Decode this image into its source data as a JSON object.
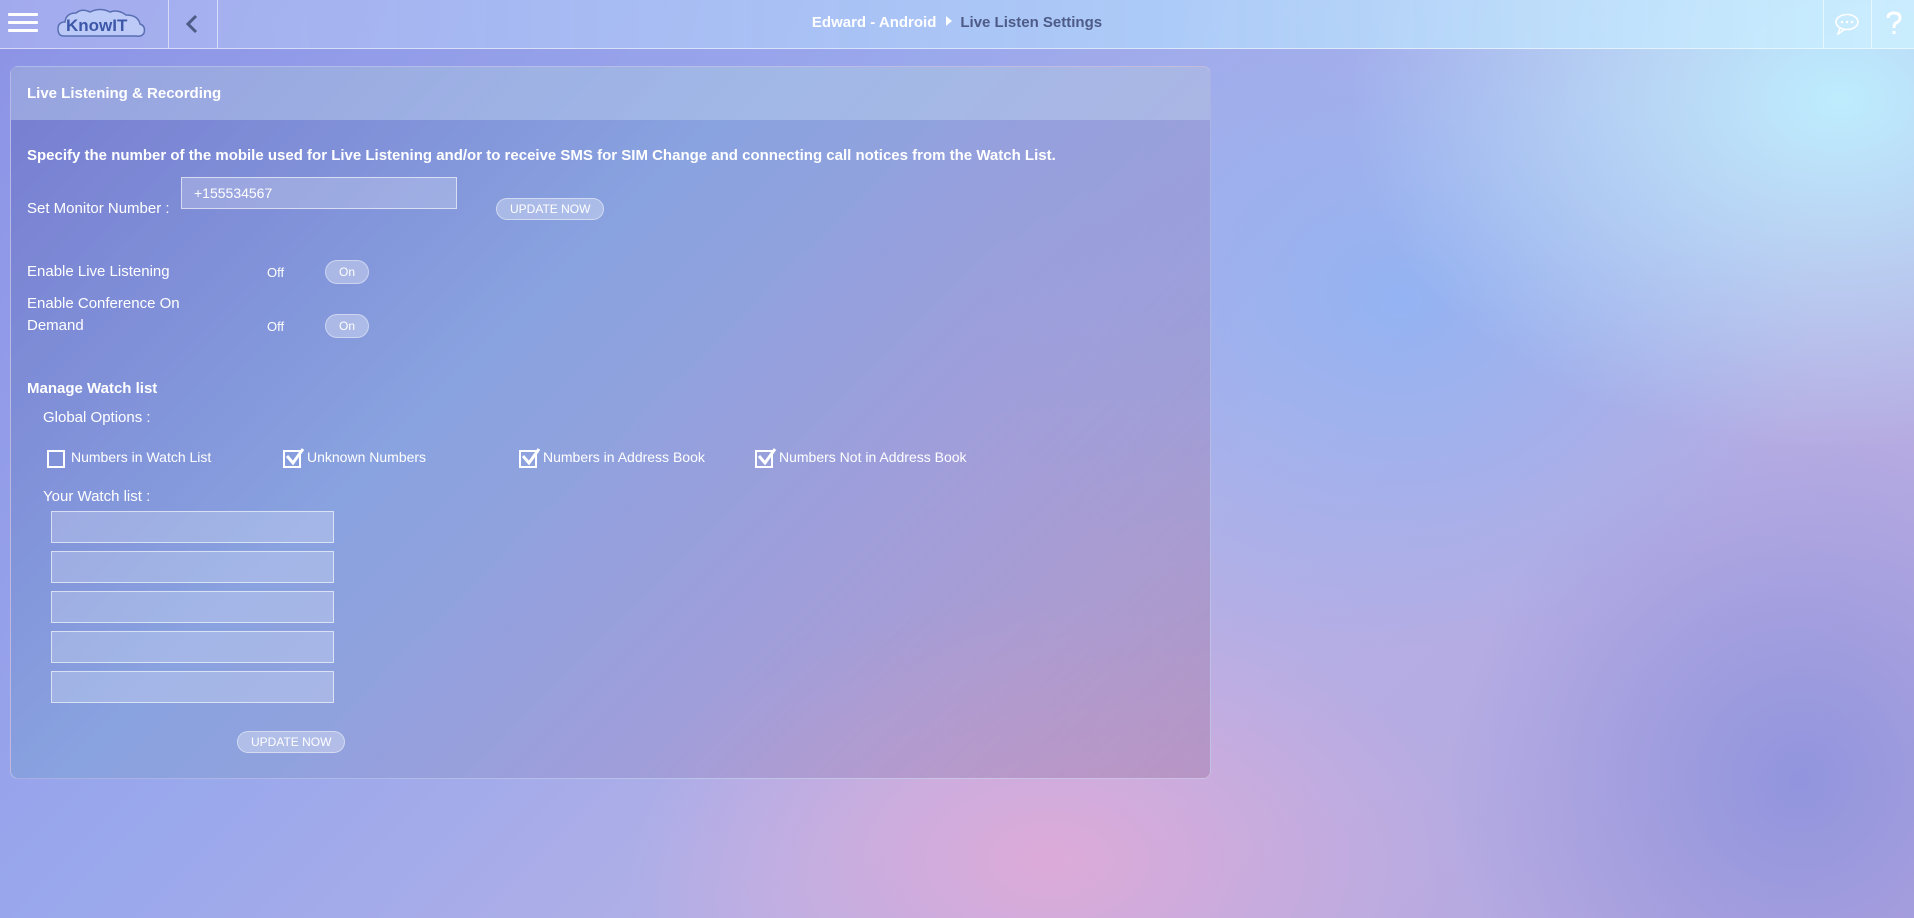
{
  "header": {
    "logo_text": "KnowIT",
    "breadcrumb": [
      "Edward - Android",
      "Live Listen Settings"
    ]
  },
  "panel": {
    "title": "Live Listening & Recording",
    "intro": "Specify the number of the mobile used for Live Listening and/or to receive SMS for SIM Change and connecting call notices from the Watch List.",
    "monitor_label": "Set Monitor Number :",
    "monitor_value": "+155534567",
    "update_now": "UPDATE NOW",
    "live_listening": {
      "label": "Enable Live Listening",
      "off": "Off",
      "on": "On"
    },
    "conference": {
      "label_line1": "Enable Conference On",
      "label_line2": "Demand",
      "off": "Off",
      "on": "On"
    },
    "watchlist": {
      "title": "Manage Watch list",
      "global_options": "Global Options :",
      "options": [
        {
          "label": "Numbers in Watch List",
          "checked": false
        },
        {
          "label": "Unknown Numbers",
          "checked": true
        },
        {
          "label": "Numbers in Address Book",
          "checked": true
        },
        {
          "label": "Numbers Not in Address Book",
          "checked": true
        }
      ],
      "your_watch_list": "Your Watch list :",
      "entries": [
        "",
        "",
        "",
        "",
        ""
      ],
      "update_now": "UPDATE NOW"
    }
  },
  "icons": {
    "menu": "hamburger-icon",
    "back": "chevron-left-icon",
    "chat": "chat-bubble-icon",
    "help": "question-mark-icon",
    "check": "checkmark-icon"
  }
}
